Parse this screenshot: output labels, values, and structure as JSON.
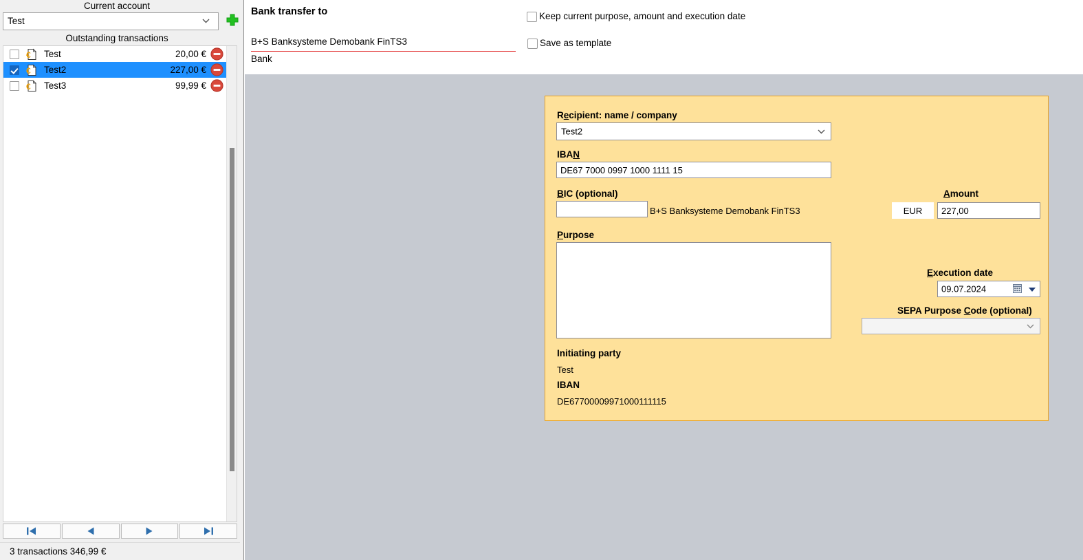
{
  "sidebar": {
    "account_label": "Current account",
    "account_selected": "Test",
    "add_account_title": "plus-icon",
    "transactions_label": "Outstanding transactions",
    "transactions": [
      {
        "checked": false,
        "name": "Test",
        "amount": "20,00 €"
      },
      {
        "checked": true,
        "name": "Test2",
        "amount": "227,00 €"
      },
      {
        "checked": false,
        "name": "Test3",
        "amount": "99,99 €"
      }
    ],
    "nav": [
      {
        "name": "first",
        "glyph": "first-page-icon"
      },
      {
        "name": "previous",
        "glyph": "previous-page-icon"
      },
      {
        "name": "next",
        "glyph": "next-page-icon"
      },
      {
        "name": "last",
        "glyph": "last-page-icon"
      }
    ],
    "status_text": "3 transactions 346,99 €"
  },
  "header": {
    "title": "Bank transfer to",
    "bank_name": "B+S Banksysteme Demobank FinTS3",
    "bank_caption": "Bank",
    "keep_checkbox_label": "Keep current purpose, amount and execution date",
    "keep_checkbox_checked": false,
    "template_checkbox_label": "Save as template",
    "template_checkbox_checked": false
  },
  "form": {
    "recipient_label_pre": "R",
    "recipient_label_mnemonic": "e",
    "recipient_label_post": "cipient: name / company",
    "recipient_value": "Test2",
    "iban_label_pre": "IBA",
    "iban_label_mnemonic": "N",
    "iban_label_post": "",
    "iban_value": "DE67 7000 0997 1000 1111 15",
    "bic_label_pre": "",
    "bic_label_mnemonic": "B",
    "bic_label_post": "IC (optional)",
    "bic_value": "",
    "bic_bank_text": "B+S Banksysteme Demobank FinTS3",
    "amount_label_pre": "",
    "amount_label_mnemonic": "A",
    "amount_label_post": "mount",
    "currency": "EUR",
    "amount_value": "227,00",
    "purpose_label_pre": "",
    "purpose_label_mnemonic": "P",
    "purpose_label_post": "urpose",
    "purpose_value": "",
    "execdate_label_pre": "",
    "execdate_label_mnemonic": "E",
    "execdate_label_post": "xecution date",
    "execdate_value": "09.07.2024",
    "sepa_label_pre": "SEPA Purpose ",
    "sepa_label_mnemonic": "C",
    "sepa_label_post": "ode (optional)",
    "sepa_value": "",
    "initiating_label": "Initiating party",
    "initiating_value": "Test",
    "party_iban_label": "IBAN",
    "party_iban_value": "DE67700009971000111115"
  },
  "colors": {
    "panel_bg": "#fee19a",
    "panel_border": "#e8a020",
    "content_bg": "#c6cad1",
    "selection": "#1e90ff",
    "accent_red": "#e02020",
    "add_green": "#22c021"
  }
}
